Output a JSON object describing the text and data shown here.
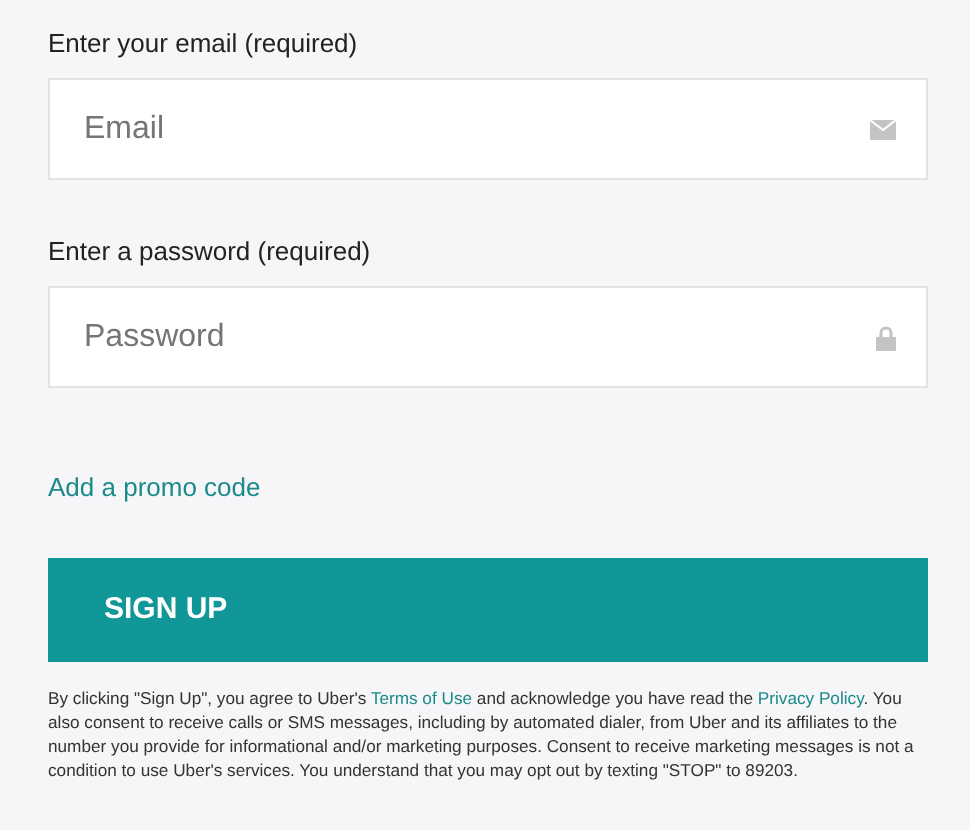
{
  "fields": [
    {
      "label": "Enter your email (required)",
      "placeholder": "Email",
      "kind": "email"
    },
    {
      "label": "Enter a password (required)",
      "placeholder": "Password",
      "kind": "password"
    }
  ],
  "promo_link": "Add a promo code",
  "submit_button": "SIGN UP",
  "legal_text": [
    {
      "kind": "text",
      "text": "By clicking \"Sign Up\", you agree to Uber's "
    },
    {
      "kind": "link",
      "text": "Terms of Use"
    },
    {
      "kind": "text",
      "text": " and acknowledge you have read the "
    },
    {
      "kind": "link",
      "text": "Privacy Policy"
    },
    {
      "kind": "text",
      "text": ". You also consent to receive calls or SMS messages, including by automated dialer, from Uber and its affiliates to the number you provide for informational and/or marketing purposes. Consent to receive marketing messages is not a condition to use Uber's services. You understand that you may opt out by texting \"STOP\" to 89203."
    }
  ]
}
